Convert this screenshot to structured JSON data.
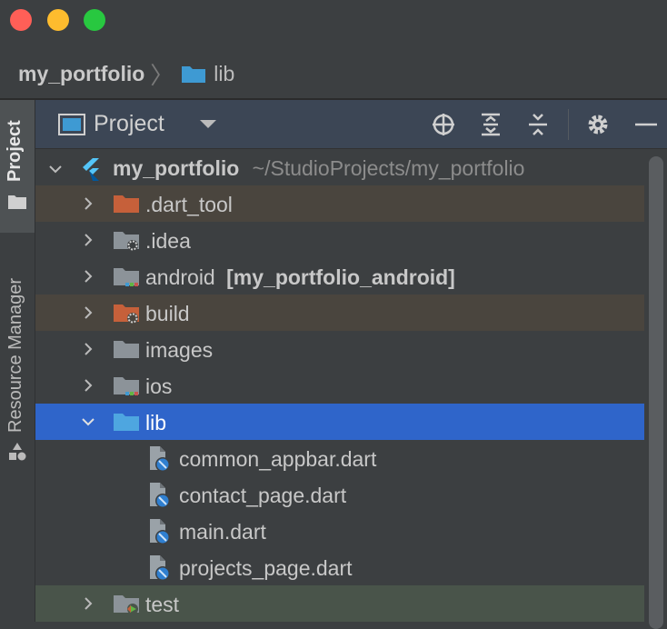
{
  "breadcrumb": {
    "project": "my_portfolio",
    "folder": "lib"
  },
  "sidebar": {
    "project_tab": "Project",
    "resource_manager_tab": "Resource Manager"
  },
  "panel": {
    "title": "Project",
    "tools": [
      "crosshair-icon",
      "expand-all-icon",
      "collapse-all-icon",
      "gear-icon",
      "minimize-icon"
    ]
  },
  "tree": {
    "root": {
      "name": "my_portfolio",
      "path": "~/StudioProjects/my_portfolio"
    },
    "items": [
      {
        "label": "Project",
        "text": ".dart_tool",
        "module": ""
      },
      {
        "text": ".idea",
        "module": ""
      },
      {
        "text": "android",
        "module": "[my_portfolio_android]"
      },
      {
        "text": "build",
        "module": ""
      },
      {
        "text": "images",
        "module": ""
      },
      {
        "text": "ios",
        "module": ""
      },
      {
        "text": "lib",
        "module": ""
      },
      {
        "text": "common_appbar.dart",
        "module": ""
      },
      {
        "text": "contact_page.dart",
        "module": ""
      },
      {
        "text": "main.dart",
        "module": ""
      },
      {
        "text": "projects_page.dart",
        "module": ""
      },
      {
        "text": "test",
        "module": ""
      }
    ]
  },
  "colors": {
    "selection": "#2f65ca",
    "excluded": "#4a453e",
    "test": "#49544a",
    "folder_blue": "#3e9ad3",
    "folder_orange": "#c6603a",
    "folder_gray": "#8c9399"
  }
}
